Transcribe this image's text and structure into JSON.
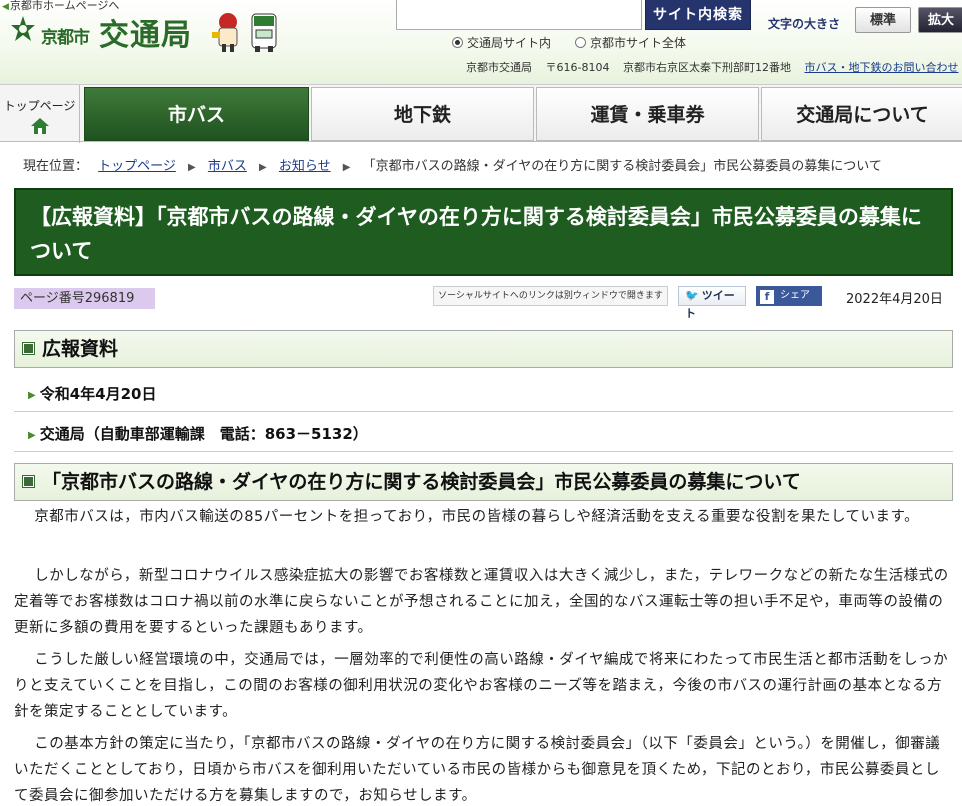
{
  "header": {
    "home_link": "京都市ホームページへ",
    "logo_city": "京都市",
    "logo_title": "交通局",
    "search_button": "サイト内検索",
    "radio_site": "交通局サイト内",
    "radio_all": "京都市サイト全体",
    "font_size_label": "文字の大きさ",
    "font_std": "標準",
    "font_big": "拡大",
    "address_org": "京都市交通局",
    "address_zip": "〒616-8104",
    "address_street": "京都市右京区太秦下刑部町12番地",
    "address_link": "市バス・地下鉄のお問い合わせ"
  },
  "nav": {
    "top_page": "トップページ",
    "items": [
      "市バス",
      "地下鉄",
      "運賃・乗車券",
      "交通局について"
    ]
  },
  "breadcrumb": {
    "label": "現在位置：",
    "links": [
      "トップページ",
      "市バス",
      "お知らせ"
    ],
    "current": "「京都市バスの路線・ダイヤの在り方に関する検討委員会」市民公募委員の募集について"
  },
  "page": {
    "title": "【広報資料】「京都市バスの路線・ダイヤの在り方に関する検討委員会」市民公募委員の募集について",
    "page_number": "ページ番号296819",
    "social_note": "ソーシャルサイトへのリンクは別ウィンドウで開きます",
    "tweet": "ツイート",
    "share": "シェア",
    "date": "2022年4月20日"
  },
  "sections": {
    "press_heading": "広報資料",
    "press_date": "令和4年4月20日",
    "press_contact": "交通局（自動車部運輸課　電話：863－5132）",
    "main_heading": "「京都市バスの路線・ダイヤの在り方に関する検討委員会」市民公募委員の募集について"
  },
  "paragraphs": [
    "京都市バスは，市内バス輸送の85パーセントを担っており，市民の皆様の暮らしや経済活動を支える重要な役割を果たしています。",
    "しかしながら，新型コロナウイルス感染症拡大の影響でお客様数と運賃収入は大きく減少し，また，テレワークなどの新たな生活様式の定着等でお客様数はコロナ禍以前の水準に戻らないことが予想されることに加え，全国的なバス運転士等の担い手不足や，車両等の設備の更新に多額の費用を要するといった課題もあります。",
    "こうした厳しい経営環境の中，交通局では，一層効率的で利便性の高い路線・ダイヤ編成で将来にわたって市民生活と都市活動をしっかりと支えていくことを目指し，この間のお客様の御利用状況の変化やお客様のニーズ等を踏まえ，今後の市バスの運行計画の基本となる方針を策定することとしています。",
    "この基本方針の策定に当たり，「京都市バスの路線・ダイヤの在り方に関する検討委員会」（以下「委員会」という。）を開催し，御審議いただくこととしており，日頃から市バスを御利用いただいている市民の皆様からも御意見を頂くため，下記のとおり，市民公募委員として委員会に御参加いただける方を募集しますので，お知らせします。"
  ],
  "colors": {
    "accent_green": "#1e5c20",
    "nav_blue": "#26346e",
    "page_no_bg": "#dcc9ee"
  }
}
